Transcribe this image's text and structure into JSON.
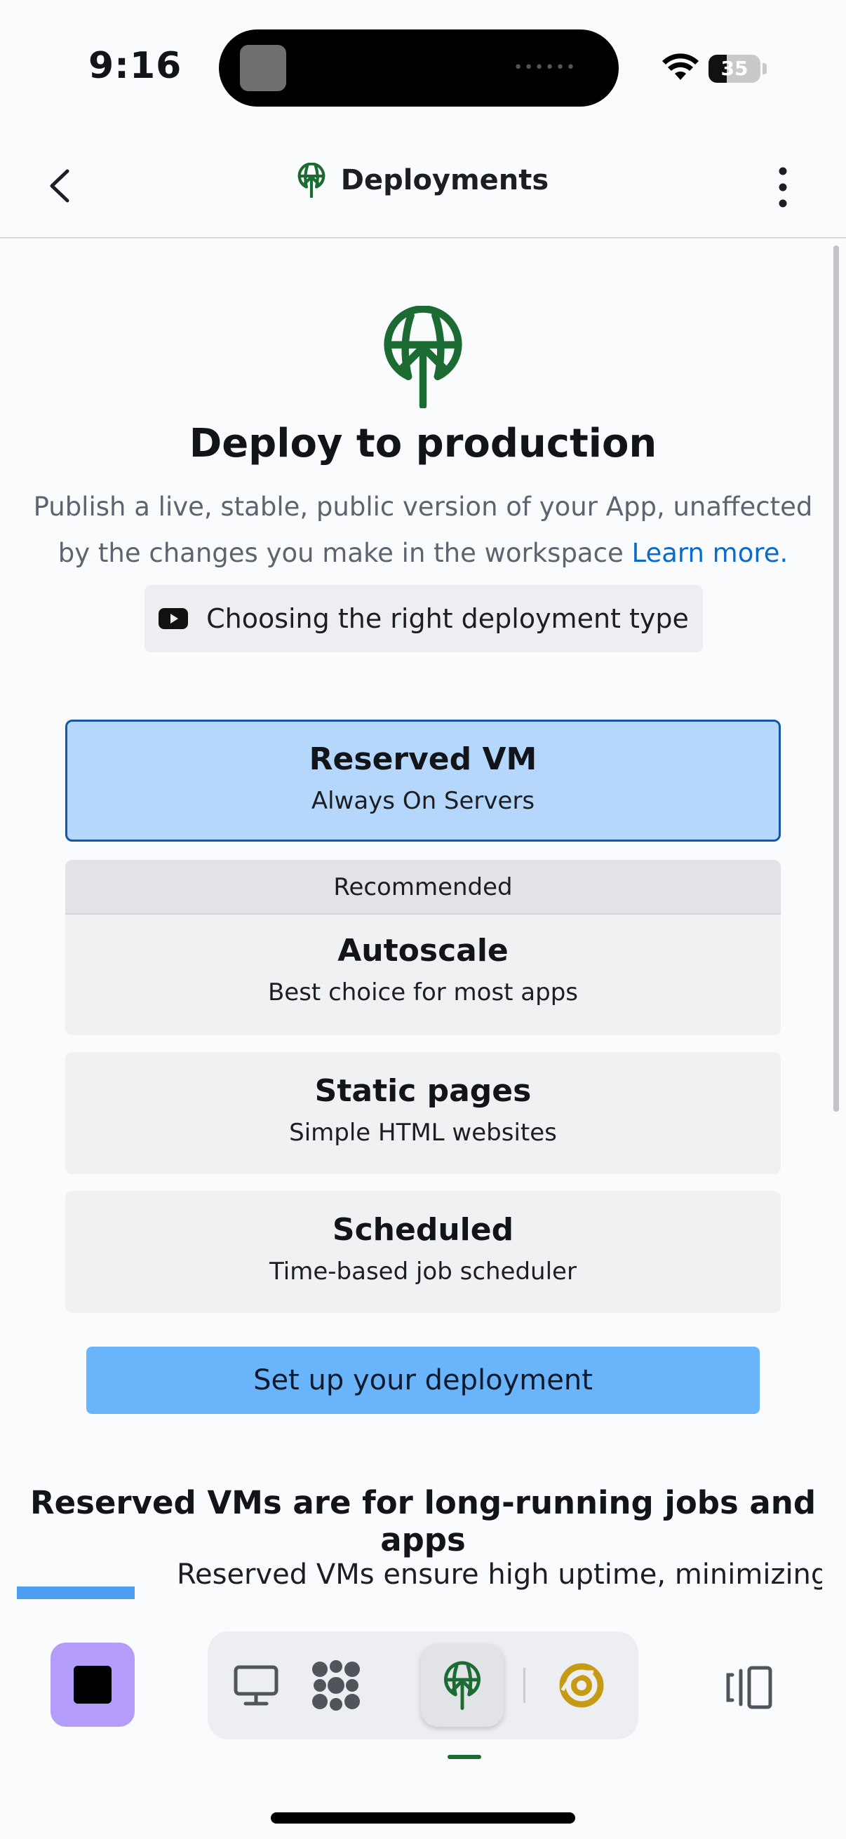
{
  "status_bar": {
    "time": "9:16",
    "battery": "35",
    "battery_level": 0.35
  },
  "nav": {
    "title": "Deployments"
  },
  "hero": {
    "title": "Deploy to production",
    "description": "Publish a live, stable, public version of your App, unaffected by the changes you make in the workspace",
    "learn_more": "Learn more.",
    "video_link": "Choosing the right deployment type"
  },
  "options": [
    {
      "title": "Reserved VM",
      "subtitle": "Always On Servers",
      "selected": true
    },
    {
      "badge": "Recommended",
      "title": "Autoscale",
      "subtitle": "Best choice for most apps",
      "selected": false
    },
    {
      "title": "Static pages",
      "subtitle": "Simple HTML websites",
      "selected": false
    },
    {
      "title": "Scheduled",
      "subtitle": "Time-based job scheduler",
      "selected": false
    }
  ],
  "primary_button": "Set up your deployment",
  "section": {
    "heading": "Reserved VMs are for long-running jobs and apps",
    "text": "Reserved VMs ensure high uptime, minimizing"
  },
  "colors": {
    "accent_green": "#1b6b32",
    "selected_card": "#b5d7fb",
    "primary_button": "#6ab4fc",
    "stop_button": "#b39cfa",
    "link": "#0b6bcb"
  },
  "icons": {
    "back": "chevron-left-icon",
    "deployments": "globe-upload-icon",
    "more": "vertical-dots-icon",
    "video": "youtube-icon",
    "stop": "stop-icon",
    "preview": "monitor-icon",
    "extensions": "grid-blobs-icon",
    "deploy": "globe-upload-icon",
    "assistant": "spiral-logo-icon",
    "panels": "side-panels-icon"
  }
}
